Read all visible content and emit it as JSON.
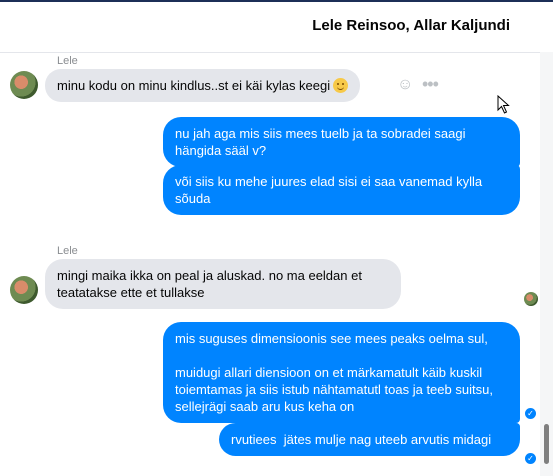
{
  "header": {
    "title": "Lele Reinsoo, Allar Kaljundi"
  },
  "messages": [
    {
      "sender": "Lele",
      "text": "minu kodu on minu kindlus..st ei käi kylas keegi"
    },
    {
      "sender": "me",
      "text": "nu jah aga mis siis mees tuelb ja ta sobradei saagi hängida sääl v?"
    },
    {
      "sender": "me",
      "text": "või siis ku mehe juures elad sisi ei saa vanemad kylla sõuda"
    },
    {
      "sender": "Lele",
      "text": "mingi maika ikka on peal ja aluskad. no ma eeldan et teatatakse ette et tullakse"
    },
    {
      "sender": "me",
      "text": "mis suguses dimensioonis see mees peaks oelma sul,\n\nmuidugi allari diensioon on et märkamatult käib kuskil toiemtamas ja siis istub nähtamatutl toas ja teeb suitsu, sellejrägi saab aru kus keha on"
    },
    {
      "sender": "me",
      "text": "rvutiees  jätes mulje nag uteeb arvutis midagi"
    }
  ],
  "icons": [
    "smiley-icon",
    "more-icon",
    "seen-check-icon",
    "mouse-cursor-icon"
  ],
  "colors": {
    "outgoing": "#0084ff",
    "incoming": "#e4e6eb",
    "header_bar": "#1c2f57"
  }
}
